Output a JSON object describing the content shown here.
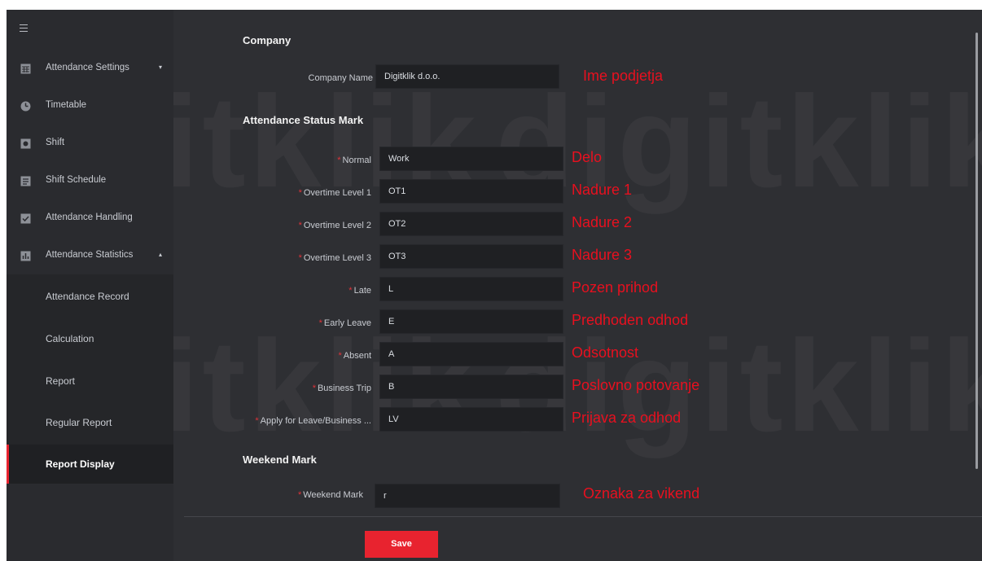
{
  "sidebar": {
    "items": [
      {
        "label": "Attendance Settings",
        "icon": "calendar-grid-icon",
        "caret": "▾"
      },
      {
        "label": "Timetable",
        "icon": "clock-icon"
      },
      {
        "label": "Shift",
        "icon": "shift-icon"
      },
      {
        "label": "Shift Schedule",
        "icon": "schedule-icon"
      },
      {
        "label": "Attendance Handling",
        "icon": "checkbox-icon"
      },
      {
        "label": "Attendance Statistics",
        "icon": "statistics-icon",
        "caret": "▴"
      }
    ],
    "sub_items": [
      {
        "label": "Attendance Record"
      },
      {
        "label": "Calculation"
      },
      {
        "label": "Report"
      },
      {
        "label": "Regular Report"
      },
      {
        "label": "Report Display",
        "active": true
      }
    ]
  },
  "company": {
    "title": "Company",
    "name_label": "Company Name",
    "name_value": "Digitklik d.o.o.",
    "annotation": "Ime podjetja"
  },
  "status_mark": {
    "title": "Attendance Status Mark",
    "rows": [
      {
        "label": "Normal",
        "value": "Work",
        "annotation": "Delo"
      },
      {
        "label": "Overtime Level 1",
        "value": "OT1",
        "annotation": "Nadure 1"
      },
      {
        "label": "Overtime Level 2",
        "value": "OT2",
        "annotation": "Nadure 2"
      },
      {
        "label": "Overtime Level 3",
        "value": "OT3",
        "annotation": "Nadure 3"
      },
      {
        "label": "Late",
        "value": "L",
        "annotation": "Pozen prihod"
      },
      {
        "label": "Early Leave",
        "value": "E",
        "annotation": "Predhoden odhod"
      },
      {
        "label": "Absent",
        "value": "A",
        "annotation": "Odsotnost"
      },
      {
        "label": "Business Trip",
        "value": "B",
        "annotation": "Poslovno potovanje"
      },
      {
        "label": "Apply for Leave/Business ...",
        "value": "LV",
        "annotation": "Prijava za odhod"
      }
    ]
  },
  "weekend": {
    "title": "Weekend Mark",
    "label": "Weekend Mark",
    "value": "r",
    "annotation": "Oznaka za vikend"
  },
  "save_label": "Save",
  "required_mark": "*",
  "watermark": "digitklik",
  "colors": {
    "accent": "#e8232f",
    "annotation": "#e8101f",
    "background": "#2e2f33"
  }
}
